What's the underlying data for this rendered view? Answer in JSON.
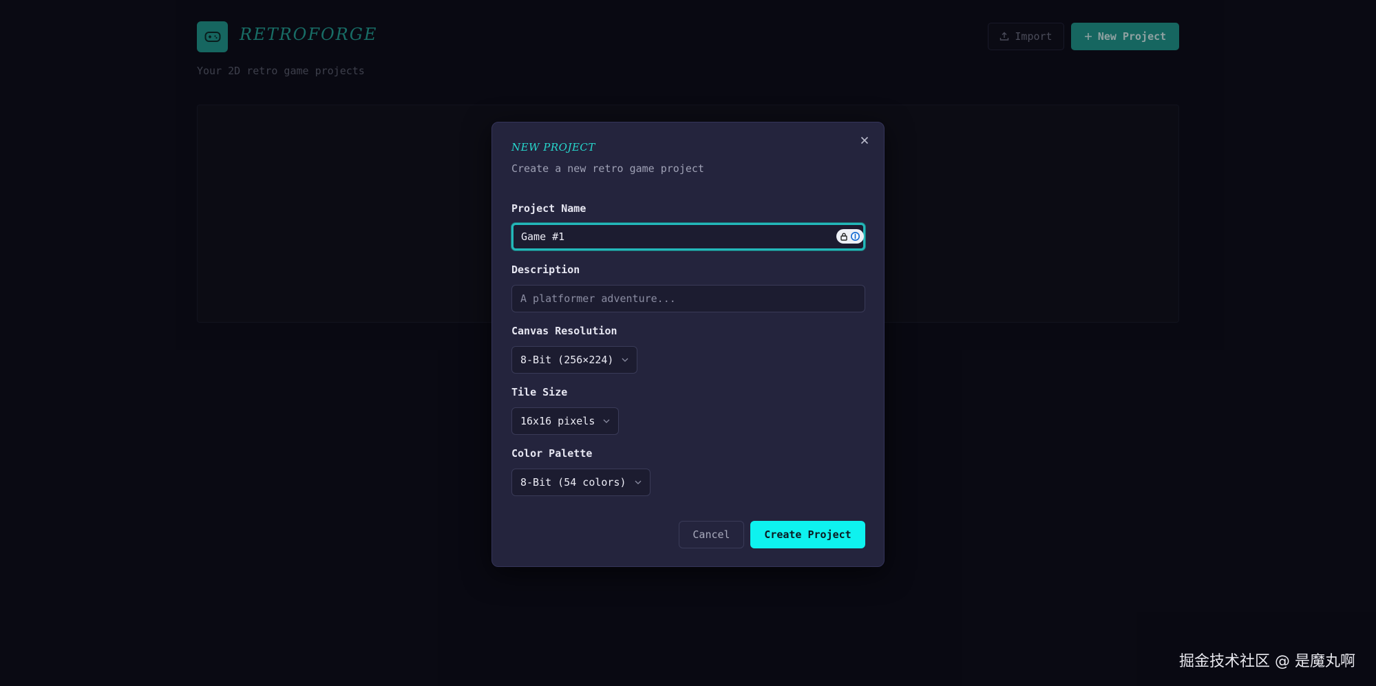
{
  "header": {
    "brand_title": "RETROFORGE",
    "subtitle": "Your 2D retro game projects",
    "logo_icon": "gamepad-icon",
    "import_label": "Import",
    "import_icon": "upload-icon",
    "new_project_label": "New Project",
    "new_project_icon": "plus-icon"
  },
  "modal": {
    "title": "NEW PROJECT",
    "description": "Create a new retro game project",
    "close_icon": "close-icon",
    "fields": {
      "project_name": {
        "label": "Project Name",
        "value": "Game #1"
      },
      "description": {
        "label": "Description",
        "value": "",
        "placeholder": "A platformer adventure..."
      },
      "canvas_resolution": {
        "label": "Canvas Resolution",
        "value": "8-Bit (256×224)"
      },
      "tile_size": {
        "label": "Tile Size",
        "value": "16x16 pixels"
      },
      "color_palette": {
        "label": "Color Palette",
        "value": "8-Bit (54 colors)"
      }
    },
    "cancel_label": "Cancel",
    "create_label": "Create Project"
  },
  "watermark": "掘金技术社区 @ 是魔丸啊",
  "colors": {
    "background": "#0c0c16",
    "accent": "#1f9a8e",
    "modal_bg": "#24243d",
    "primary_button": "#0ef2ef",
    "title_accent": "#27d7cd"
  }
}
